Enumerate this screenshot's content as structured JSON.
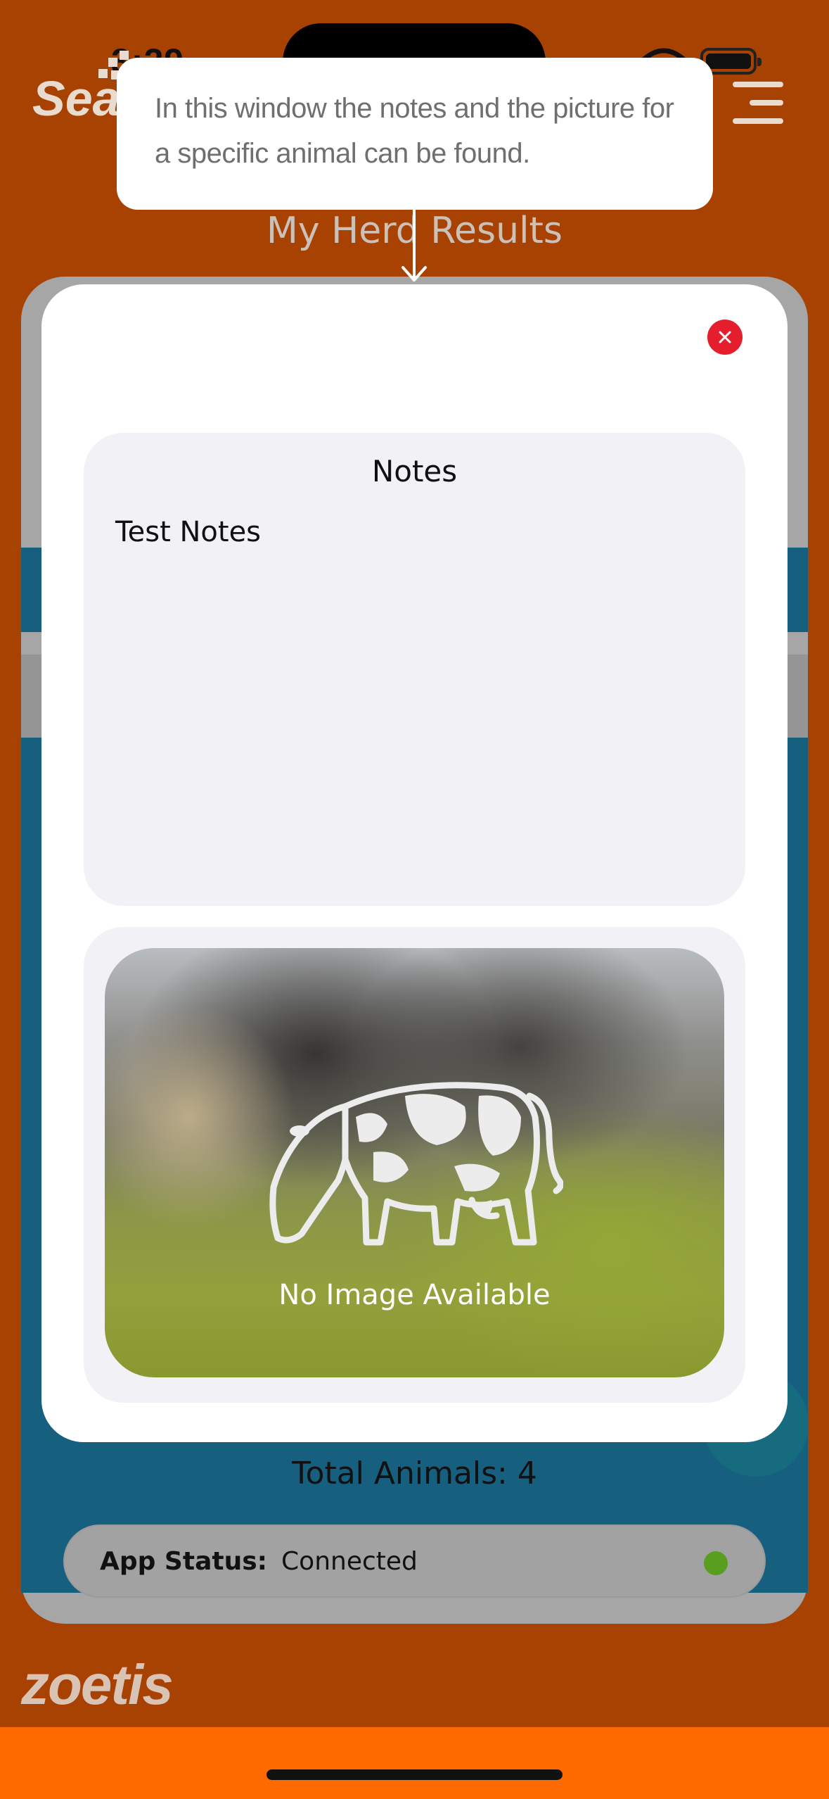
{
  "status_bar": {
    "time": "3:29"
  },
  "header": {
    "logo_text": "Search",
    "page_title": "My Herd Results"
  },
  "tooltip": {
    "text": "In this window the notes and the picture for a specific animal can be found."
  },
  "modal": {
    "notes_title": "Notes",
    "notes_text": "Test Notes",
    "image_placeholder_text": "No Image Available"
  },
  "summary": {
    "total_animals": "Total Animals: 4",
    "app_status_label": "App Status:",
    "app_status_value": "Connected"
  },
  "footer": {
    "logo_text": "zoetis"
  },
  "icons": [
    "wifi-icon",
    "battery-icon",
    "menu-icon",
    "close-icon",
    "cow-icon",
    "arrow-down-icon"
  ],
  "colors": {
    "background": "#a84203",
    "bottom_bar": "#ff6a00",
    "close_button": "#e41e2d",
    "status_connected": "#5a9e1f",
    "accent_blue": "#165f7f"
  }
}
